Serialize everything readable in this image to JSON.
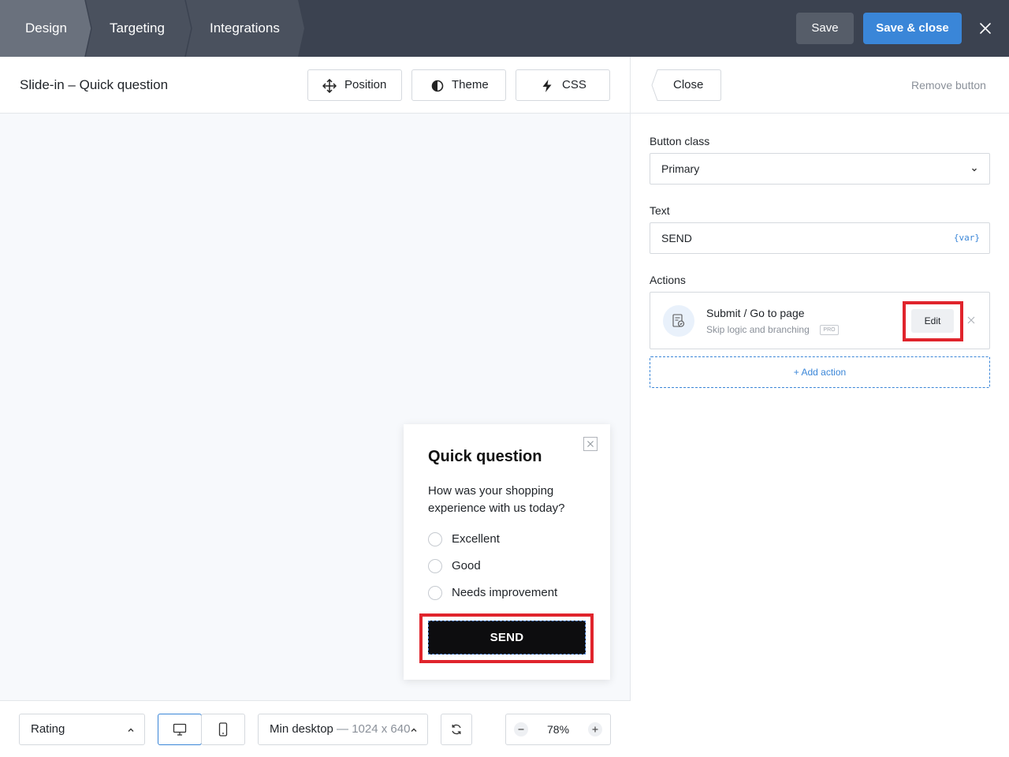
{
  "topbar": {
    "steps": [
      "Design",
      "Targeting",
      "Integrations"
    ],
    "save_label": "Save",
    "save_close_label": "Save & close"
  },
  "editor": {
    "title": "Slide-in – Quick question",
    "buttons": {
      "position": "Position",
      "theme": "Theme",
      "css": "CSS"
    }
  },
  "popup": {
    "title": "Quick question",
    "question": "How was your shopping experience with us today?",
    "options": [
      "Excellent",
      "Good",
      "Needs improvement"
    ],
    "send_label": "SEND"
  },
  "bottombar": {
    "step_select": "Rating",
    "device_label": "Min desktop",
    "device_size": "— 1024 x 640",
    "zoom": "78%"
  },
  "panel": {
    "close_label": "Close",
    "remove_label": "Remove button",
    "button_class_label": "Button class",
    "button_class_value": "Primary",
    "text_label": "Text",
    "text_value": "SEND",
    "var_label": "{var}",
    "actions_label": "Actions",
    "action": {
      "title": "Submit / Go to page",
      "subtitle": "Skip logic and branching",
      "badge": "PRO",
      "edit_label": "Edit"
    },
    "add_action_label": "+ Add action"
  },
  "colors": {
    "topbar_bg": "#3b4250",
    "accent": "#3a86d8",
    "highlight": "#e0242c",
    "send_bg": "#0d0d0f",
    "canvas_bg": "#f7f9fc"
  }
}
